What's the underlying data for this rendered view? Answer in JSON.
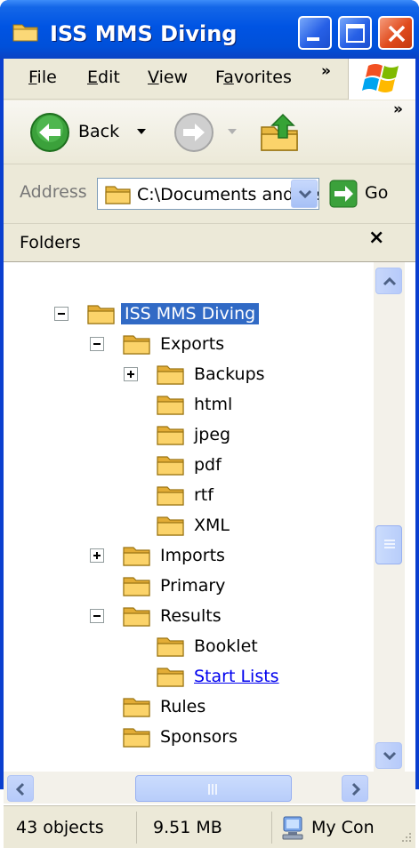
{
  "window": {
    "title": "ISS MMS Diving"
  },
  "menu": {
    "items": [
      {
        "label": "File",
        "key": "F",
        "rest": "ile"
      },
      {
        "label": "Edit",
        "key": "E",
        "rest": "dit"
      },
      {
        "label": "View",
        "key": "V",
        "rest": "iew"
      },
      {
        "label": "Favorites",
        "pre": "F",
        "key": "a",
        "rest": "vorites"
      }
    ],
    "overflow": "»"
  },
  "toolbar": {
    "back_label": "Back",
    "overflow": "»"
  },
  "address": {
    "label": "Address",
    "value": "C:\\Documents and Settings",
    "go_label": "Go"
  },
  "folders_pane": {
    "title": "Folders",
    "close": "×",
    "tree": [
      {
        "label": "ISS MMS Diving",
        "expander": "minus",
        "selected": true
      },
      {
        "label": "Exports",
        "expander": "minus"
      },
      {
        "label": "Backups",
        "expander": "plus"
      },
      {
        "label": "html"
      },
      {
        "label": "jpeg"
      },
      {
        "label": "pdf"
      },
      {
        "label": "rtf"
      },
      {
        "label": "XML"
      },
      {
        "label": "Imports",
        "expander": "plus"
      },
      {
        "label": "Primary"
      },
      {
        "label": "Results",
        "expander": "minus"
      },
      {
        "label": "Booklet"
      },
      {
        "label": "Start Lists",
        "hover": true
      },
      {
        "label": "Rules"
      },
      {
        "label": "Sponsors"
      }
    ]
  },
  "statusbar": {
    "objects": "43 objects",
    "size": "9.51 MB",
    "zone": "My Con"
  },
  "colors": {
    "titlebar": "#0054e3",
    "selection": "#316ac5",
    "frame": "#ece9d8",
    "folder": "#f5c95a"
  },
  "icons": [
    "folder-icon",
    "back-arrow-icon",
    "forward-arrow-icon",
    "up-folder-icon",
    "go-arrow-icon",
    "windows-logo-icon",
    "my-computer-icon"
  ]
}
